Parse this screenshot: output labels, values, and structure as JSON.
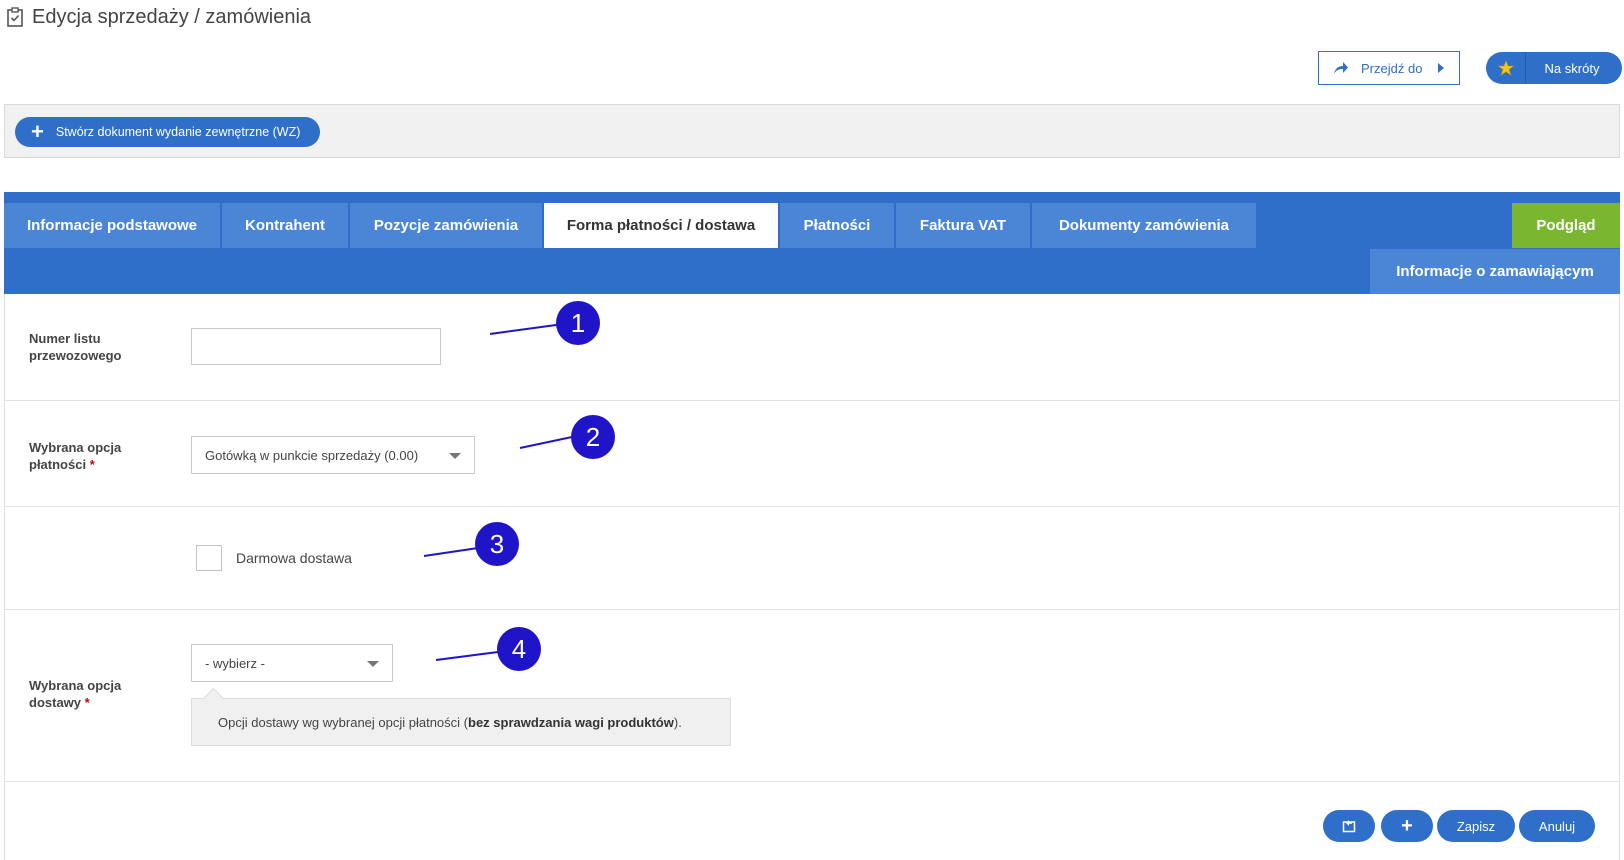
{
  "header": {
    "title": "Edycja sprzedaży / zamówienia",
    "title_icon": "clipboard-check-icon",
    "goto_label": "Przejdź do",
    "shortcuts_label": "Na skróty"
  },
  "actions": {
    "create_wz_label": "Stwórz dokument wydanie zewnętrzne (WZ)"
  },
  "tabs": [
    {
      "label": "Informacje podstawowe"
    },
    {
      "label": "Kontrahent"
    },
    {
      "label": "Pozycje zamówienia"
    },
    {
      "label": "Forma płatności / dostawa",
      "active": true
    },
    {
      "label": "Płatności"
    },
    {
      "label": "Faktura VAT"
    },
    {
      "label": "Dokumenty zamówienia"
    }
  ],
  "preview_tab": {
    "label": "Podgląd"
  },
  "sub_tab": {
    "label": "Informacje o zamawiającym"
  },
  "form": {
    "waybill": {
      "label_line1": "Numer listu",
      "label_line2": "przewozowego",
      "value": ""
    },
    "payment": {
      "label_line1": "Wybrana opcja",
      "label_line2": "płatności",
      "required_mark": "*",
      "selected": "Gotówką w punkcie sprzedaży (0.00)"
    },
    "free_shipping": {
      "label": "Darmowa dostawa",
      "checked": false
    },
    "delivery": {
      "label_line1": "Wybrana opcja",
      "label_line2": "dostawy",
      "required_mark": "*",
      "selected": "- wybierz -"
    },
    "hint": {
      "prefix": "Opcji dostawy wg wybranej opcji płatności (",
      "bold": "bez sprawdzania wagi produktów",
      "suffix": ")."
    }
  },
  "annotations": [
    {
      "number": "1"
    },
    {
      "number": "2"
    },
    {
      "number": "3"
    },
    {
      "number": "4"
    }
  ],
  "bottom_actions": {
    "save_label": "Zapisz",
    "cancel_label": "Anuluj"
  },
  "colors": {
    "primary": "#2f6fc9",
    "tab": "#4b86d6",
    "preview": "#7ab62f",
    "annotation": "#1f14c8"
  }
}
